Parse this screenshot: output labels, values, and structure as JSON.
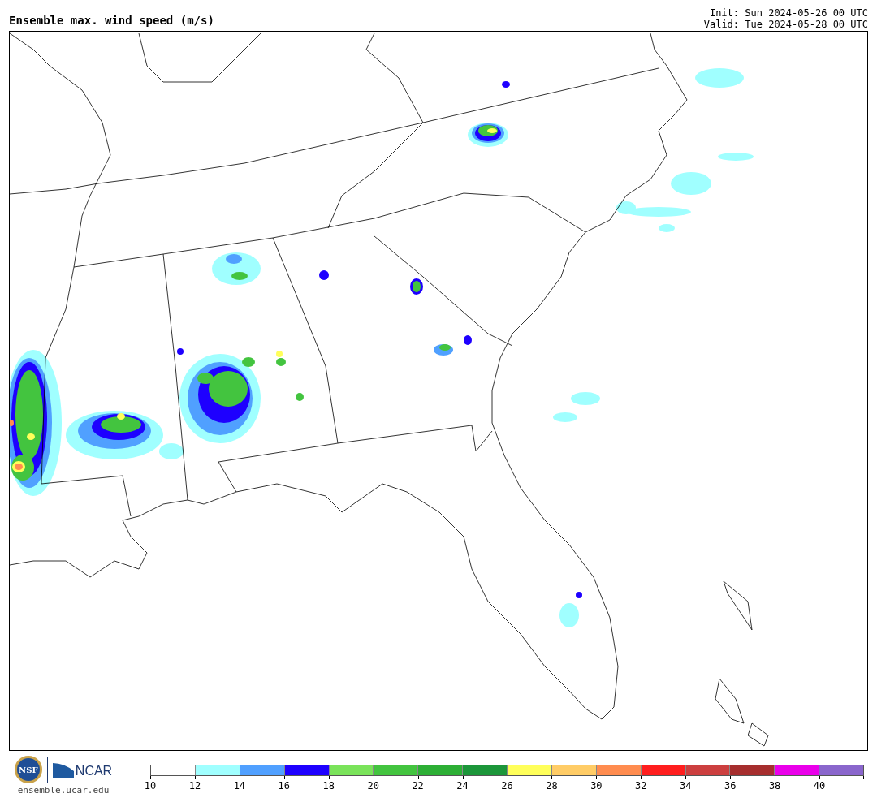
{
  "title": "Ensemble max. wind speed (m/s)",
  "init": "Init: Sun 2024-05-26 00 UTC",
  "valid": "Valid: Tue 2024-05-28 00 UTC",
  "logos": {
    "seal_text": "NSF",
    "org_text": "NCAR",
    "site": "ensemble.ucar.edu"
  },
  "colorbar": {
    "bins": [
      {
        "color": "#ffffff"
      },
      {
        "color": "#a0ffff"
      },
      {
        "color": "#50a0ff"
      },
      {
        "color": "#1e00ff"
      },
      {
        "color": "#7ae35a"
      },
      {
        "color": "#43c43f"
      },
      {
        "color": "#2daf35"
      },
      {
        "color": "#1c963a"
      },
      {
        "color": "#ffff5a"
      },
      {
        "color": "#ffcc66"
      },
      {
        "color": "#ff8c4f"
      },
      {
        "color": "#ff1e1e"
      },
      {
        "color": "#cc3f3f"
      },
      {
        "color": "#a62e2e"
      },
      {
        "color": "#ea00ea"
      },
      {
        "color": "#8a66cc"
      }
    ],
    "ticks": [
      "10",
      "12",
      "14",
      "16",
      "18",
      "20",
      "22",
      "24",
      "26",
      "28",
      "30",
      "32",
      "34",
      "36",
      "38",
      "40"
    ]
  }
}
